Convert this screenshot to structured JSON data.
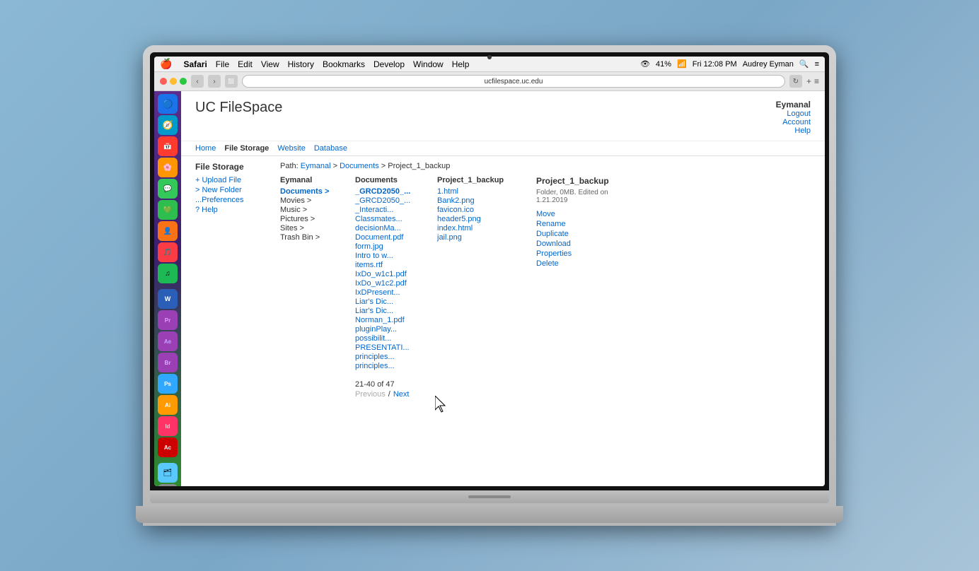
{
  "menubar": {
    "apple": "🍎",
    "safari": "Safari",
    "items": [
      "File",
      "Edit",
      "View",
      "History",
      "Bookmarks",
      "Develop",
      "Window",
      "Help"
    ],
    "right": {
      "eye_icon": "👁",
      "battery": "41%",
      "time": "Fri 12:08 PM",
      "user": "Audrey Eyman",
      "search_icon": "🔍",
      "list_icon": "≡"
    }
  },
  "browser": {
    "url": "ucfilespace.uc.edu",
    "back": "‹",
    "forward": "›"
  },
  "page": {
    "title": "UC FileSpace",
    "nav": {
      "home": "Home",
      "file_storage": "File Storage",
      "website": "Website",
      "database": "Database"
    },
    "user": {
      "name": "Eymanal",
      "logout": "Logout",
      "account": "Account",
      "help": "Help"
    },
    "file_storage": {
      "heading": "File Storage",
      "actions": {
        "upload": "+ Upload File",
        "new_folder": "> New Folder",
        "preferences": "...Preferences",
        "help": "? Help"
      }
    },
    "path": {
      "label": "Path:",
      "parts": [
        "Eymanal",
        "Documents",
        "Project_1_backup"
      ]
    },
    "columns": {
      "eymanal": {
        "header": "Eymanal",
        "items": [
          "Documents >",
          "Movies >",
          "Music >",
          "Pictures >",
          "Sites >",
          "Trash Bin >"
        ]
      },
      "documents": {
        "header": "Documents",
        "items": [
          "_GRCD2050_...",
          "_GRCD2050_...",
          "_Interacti...",
          "Classmates...",
          "decisionMa...",
          "Document.pdf",
          "form.jpg",
          "Intro to w...",
          "items.rtf",
          "IxDo_w1c1.pdf",
          "IxDo_w1c2.pdf",
          "IxDPresent...",
          "Liar's Dic...",
          "Liar's Dic...",
          "Norman_1.pdf",
          "pluginPlay...",
          "possibilit...",
          "PRESENTATI...",
          "principles...",
          "principles..."
        ]
      },
      "project_1_backup": {
        "header": "Project_1_backup",
        "items": [
          "1.html",
          "Bank2.png",
          "favicon.ico",
          "header5.png",
          "index.html",
          "jail.png"
        ]
      }
    },
    "selected": {
      "name": "Project_1_backup",
      "info": "Folder, 0MB. Edited on 1.21.2019",
      "actions": [
        "Move",
        "Rename",
        "Duplicate",
        "Download",
        "Properties",
        "Delete"
      ]
    },
    "pagination": {
      "range": "21-40 of 47",
      "previous": "Previous",
      "separator": "/",
      "next": "Next"
    }
  },
  "dock": {
    "icons": [
      {
        "name": "finder",
        "color": "#1a73e8",
        "glyph": "🔵"
      },
      {
        "name": "safari",
        "color": "#0099ff",
        "glyph": "🧭"
      },
      {
        "name": "calendar",
        "color": "#ff3b30",
        "glyph": "📅"
      },
      {
        "name": "photos",
        "color": "#ff9500",
        "glyph": "🌸"
      },
      {
        "name": "messages",
        "color": "#34c759",
        "glyph": "💬"
      },
      {
        "name": "wechat",
        "color": "#34c759",
        "glyph": "💚"
      },
      {
        "name": "contacts",
        "color": "#f97316",
        "glyph": "👤"
      },
      {
        "name": "music",
        "color": "#fc3c44",
        "glyph": "🎵"
      },
      {
        "name": "spotify",
        "color": "#1db954",
        "glyph": "🎶"
      },
      {
        "name": "word",
        "color": "#2b5eb7",
        "glyph": "W"
      },
      {
        "name": "premiere",
        "color": "#9b59b6",
        "glyph": "Pr"
      },
      {
        "name": "after-effects",
        "color": "#9b59b6",
        "glyph": "Ae"
      },
      {
        "name": "bridge",
        "color": "#9b59b6",
        "glyph": "Br"
      },
      {
        "name": "photoshop",
        "color": "#31a8ff",
        "glyph": "Ps"
      },
      {
        "name": "illustrator",
        "color": "#ff9a00",
        "glyph": "Ai"
      },
      {
        "name": "indesign",
        "color": "#ff3366",
        "glyph": "Id"
      },
      {
        "name": "acrobat",
        "color": "#ff0000",
        "glyph": "Ac"
      },
      {
        "name": "finder2",
        "color": "#5ac8fa",
        "glyph": "🗂"
      },
      {
        "name": "trash",
        "color": "#888",
        "glyph": "🗑"
      }
    ]
  }
}
